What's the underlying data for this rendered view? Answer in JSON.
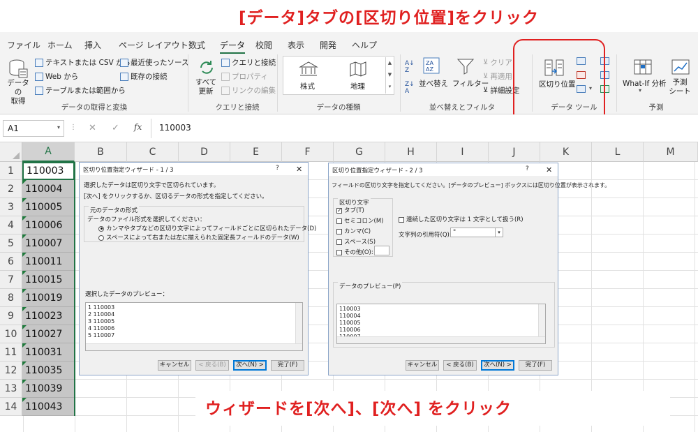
{
  "annotations": {
    "top": "[データ]タブの[区切り位置]をクリック",
    "bottom": "ウィザードを[次へ]、[次へ] をクリック",
    "accent": "#e02020"
  },
  "tabs": [
    "ファイル",
    "ホーム",
    "挿入",
    "ページ レイアウト",
    "数式",
    "データ",
    "校閲",
    "表示",
    "開発",
    "ヘルプ"
  ],
  "ribbon": {
    "get_data": {
      "big_label_line1": "データの",
      "big_label_line2": "取得",
      "from_text_csv": "テキストまたは CSV から",
      "from_web": "Web から",
      "from_table": "テーブルまたは範囲から",
      "recent_sources": "最近使ったソース",
      "existing_connections": "既存の接続",
      "group_label": "データの取得と変換"
    },
    "queries": {
      "refresh_all_line1": "すべて",
      "refresh_all_line2": "更新",
      "queries_connections": "クエリと接続",
      "properties": "プロパティ",
      "edit_links": "リンクの編集",
      "group_label": "クエリと接続"
    },
    "data_types": {
      "stocks": "株式",
      "geography": "地理",
      "group_label": "データの種類"
    },
    "sort_filter": {
      "sort": "並べ替え",
      "filter": "フィルター",
      "clear": "クリア",
      "reapply": "再適用",
      "advanced": "詳細設定",
      "group_label": "並べ替えとフィルター"
    },
    "data_tools": {
      "text_to_columns": "区切り位置",
      "group_label": "データ ツール"
    },
    "forecast": {
      "what_if": "What-If 分析",
      "forecast_sheet_line1": "予測",
      "forecast_sheet_line2": "シート",
      "group_label": "予測"
    }
  },
  "formula_bar": {
    "name_box": "A1",
    "fx": "fx",
    "value": "110003"
  },
  "columns": [
    "A",
    "B",
    "C",
    "D",
    "E",
    "F",
    "G",
    "H",
    "I",
    "J",
    "K",
    "L",
    "M"
  ],
  "rows": [
    "1",
    "2",
    "3",
    "4",
    "5",
    "6",
    "7",
    "8",
    "9",
    "10",
    "11",
    "12",
    "13",
    "14"
  ],
  "column_a": [
    "110003",
    "110004",
    "110005",
    "110006",
    "110007",
    "110011",
    "110015",
    "110019",
    "110023",
    "110027",
    "110031",
    "110035",
    "110039",
    "110043"
  ],
  "wizard1": {
    "title": "区切り位置指定ウィザード - 1 / 3",
    "line1": "選択したデータは区切り文字で区切られています。",
    "line2": "[次へ] をクリックするか、区切るデータの形式を指定してください。",
    "fieldset": "元のデータの形式",
    "prompt": "データのファイル形式を選択してください：",
    "option1": "カンマやタブなどの区切り文字によってフィールドごとに区切られたデータ(D)",
    "option2": "スペースによって右または左に揃えられた固定長フィールドのデータ(W)",
    "preview_label": "選択したデータのプレビュー：",
    "preview_lines": [
      "1 110003",
      "2 110004",
      "3 110005",
      "4 110006",
      "5 110007"
    ],
    "cancel": "キャンセル",
    "back": "< 戻る(B)",
    "next": "次へ(N) >",
    "finish": "完了(F)"
  },
  "wizard2": {
    "title": "区切り位置指定ウィザード - 2 / 3",
    "line1": "フィールドの区切り文字を指定してください。[データのプレビュー] ボックスには区切り位置が表示されます。",
    "delims_label": "区切り文字",
    "tab": "タブ(T)",
    "semicolon": "セミコロン(M)",
    "comma": "カンマ(C)",
    "space": "スペース(S)",
    "other": "その他(O):",
    "consecutive": "連続した区切り文字は 1 文字として扱う(R)",
    "qualifier_label": "文字列の引用符(Q):",
    "qualifier_value": "\"",
    "preview_label": "データのプレビュー(P)",
    "preview_lines": [
      "110003",
      "110004",
      "110005",
      "110006",
      "110007"
    ],
    "cancel": "キャンセル",
    "back": "< 戻る(B)",
    "next": "次へ(N) >",
    "finish": "完了(F)"
  }
}
